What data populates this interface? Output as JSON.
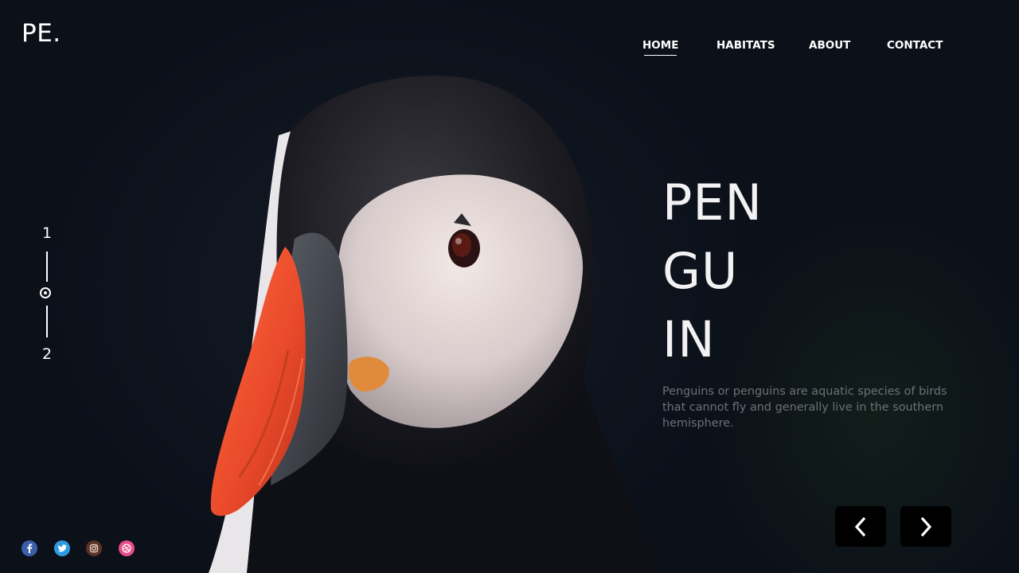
{
  "brand": {
    "logo": "PE."
  },
  "nav": {
    "items": [
      {
        "label": "HOME",
        "active": true
      },
      {
        "label": "HABITATS",
        "active": false
      },
      {
        "label": "ABOUT",
        "active": false
      },
      {
        "label": "CONTACT",
        "active": false
      }
    ]
  },
  "slider": {
    "first": "1",
    "last": "2",
    "current": 1
  },
  "hero": {
    "title_lines": [
      "PEN",
      "GU",
      "IN"
    ],
    "description": "Penguins or penguins are aquatic species of birds that cannot fly and generally live in the southern hemisphere."
  },
  "controls": {
    "prev_icon": "chevron-left-icon",
    "next_icon": "chevron-right-icon"
  },
  "social": [
    {
      "name": "facebook-icon",
      "color": "#3a5eaa"
    },
    {
      "name": "twitter-icon",
      "color": "#2e9be0"
    },
    {
      "name": "instagram-icon",
      "color": "#5a3327"
    },
    {
      "name": "dribbble-icon",
      "color": "#e84d8a"
    }
  ],
  "colors": {
    "background": "#0b1019",
    "text": "#ffffff",
    "description": "#6d7078",
    "beak": "#e8532d"
  }
}
